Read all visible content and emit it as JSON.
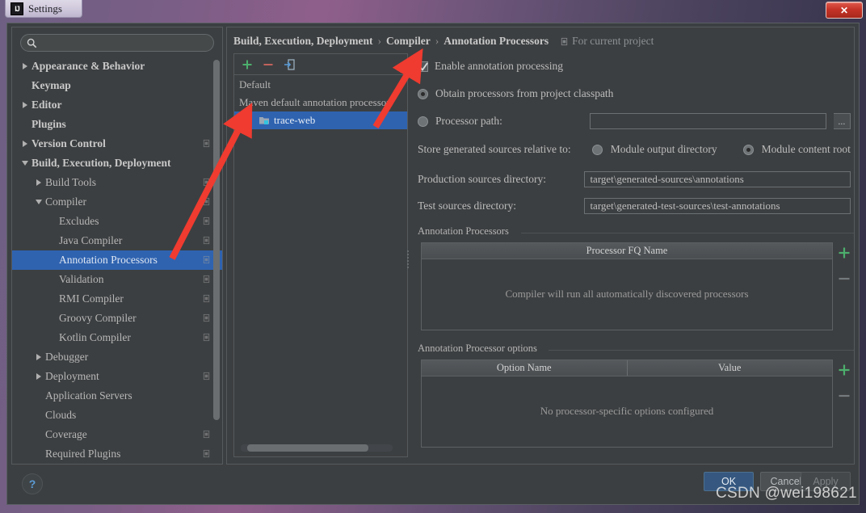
{
  "window": {
    "title": "Settings",
    "logo_text": "IJ",
    "close_label": "✕"
  },
  "search": {
    "value": "",
    "placeholder": ""
  },
  "sidebar": {
    "items": [
      {
        "label": "Appearance & Behavior",
        "twisty": "right",
        "indent": 0,
        "bold": true,
        "copy": false,
        "selected": false
      },
      {
        "label": "Keymap",
        "twisty": "none",
        "indent": 0,
        "bold": true,
        "copy": false,
        "selected": false
      },
      {
        "label": "Editor",
        "twisty": "right",
        "indent": 0,
        "bold": true,
        "copy": false,
        "selected": false
      },
      {
        "label": "Plugins",
        "twisty": "none",
        "indent": 0,
        "bold": true,
        "copy": false,
        "selected": false
      },
      {
        "label": "Version Control",
        "twisty": "right",
        "indent": 0,
        "bold": true,
        "copy": true,
        "selected": false
      },
      {
        "label": "Build, Execution, Deployment",
        "twisty": "down",
        "indent": 0,
        "bold": true,
        "copy": false,
        "selected": false
      },
      {
        "label": "Build Tools",
        "twisty": "right",
        "indent": 1,
        "bold": false,
        "copy": true,
        "selected": false
      },
      {
        "label": "Compiler",
        "twisty": "down",
        "indent": 1,
        "bold": false,
        "copy": true,
        "selected": false
      },
      {
        "label": "Excludes",
        "twisty": "none",
        "indent": 2,
        "bold": false,
        "copy": true,
        "selected": false
      },
      {
        "label": "Java Compiler",
        "twisty": "none",
        "indent": 2,
        "bold": false,
        "copy": true,
        "selected": false
      },
      {
        "label": "Annotation Processors",
        "twisty": "none",
        "indent": 2,
        "bold": false,
        "copy": true,
        "selected": true
      },
      {
        "label": "Validation",
        "twisty": "none",
        "indent": 2,
        "bold": false,
        "copy": true,
        "selected": false
      },
      {
        "label": "RMI Compiler",
        "twisty": "none",
        "indent": 2,
        "bold": false,
        "copy": true,
        "selected": false
      },
      {
        "label": "Groovy Compiler",
        "twisty": "none",
        "indent": 2,
        "bold": false,
        "copy": true,
        "selected": false
      },
      {
        "label": "Kotlin Compiler",
        "twisty": "none",
        "indent": 2,
        "bold": false,
        "copy": true,
        "selected": false
      },
      {
        "label": "Debugger",
        "twisty": "right",
        "indent": 1,
        "bold": false,
        "copy": false,
        "selected": false
      },
      {
        "label": "Deployment",
        "twisty": "right",
        "indent": 1,
        "bold": false,
        "copy": true,
        "selected": false
      },
      {
        "label": "Application Servers",
        "twisty": "none",
        "indent": 1,
        "bold": false,
        "copy": false,
        "selected": false
      },
      {
        "label": "Clouds",
        "twisty": "none",
        "indent": 1,
        "bold": false,
        "copy": false,
        "selected": false
      },
      {
        "label": "Coverage",
        "twisty": "none",
        "indent": 1,
        "bold": false,
        "copy": true,
        "selected": false
      },
      {
        "label": "Required Plugins",
        "twisty": "none",
        "indent": 1,
        "bold": false,
        "copy": true,
        "selected": false
      }
    ]
  },
  "breadcrumb": {
    "part1": "Build, Execution, Deployment",
    "sep1": "›",
    "part2": "Compiler",
    "sep2": "›",
    "part3": "Annotation Processors",
    "scope": "For current project"
  },
  "profiles": {
    "toolbar": {
      "add": "+",
      "remove": "−",
      "move": "move-to-icon"
    },
    "items": [
      {
        "label": "Default",
        "module": false,
        "selected": false
      },
      {
        "label": "Maven default annotation processor",
        "module": false,
        "selected": false
      },
      {
        "label": "trace-web",
        "module": true,
        "selected": true
      }
    ]
  },
  "settings": {
    "enable_label": "Enable annotation processing",
    "enable_checked": true,
    "source_mode": "classpath",
    "obtain_label": "Obtain processors from project classpath",
    "processor_path_label": "Processor path:",
    "processor_path_value": "",
    "browse_label": "...",
    "store_label": "Store generated sources relative to:",
    "store_mode": "content_root",
    "module_output_label": "Module output directory",
    "module_content_label": "Module content root",
    "production_label": "Production sources directory:",
    "production_value": "target\\generated-sources\\annotations",
    "test_label": "Test sources directory:",
    "test_value": "target\\generated-test-sources\\test-annotations",
    "processors_group": {
      "title": "Annotation Processors",
      "columns": [
        "Processor FQ Name"
      ],
      "rows": [],
      "empty_text": "Compiler will run all automatically discovered processors",
      "add": "+",
      "remove": "−"
    },
    "options_group": {
      "title": "Annotation Processor options",
      "columns": [
        "Option Name",
        "Value"
      ],
      "rows": [],
      "empty_text": "No processor-specific options configured",
      "add": "+",
      "remove": "−"
    }
  },
  "footer": {
    "help": "?",
    "ok": "OK",
    "cancel": "Cancel",
    "apply": "Apply"
  },
  "watermark": "CSDN @wei198621",
  "colors": {
    "accent": "#2f63b0",
    "ok_button": "#365880",
    "plus_green": "#4caf6d",
    "arrow_red": "#ef3b30",
    "panel_bg": "#3c3f41"
  }
}
